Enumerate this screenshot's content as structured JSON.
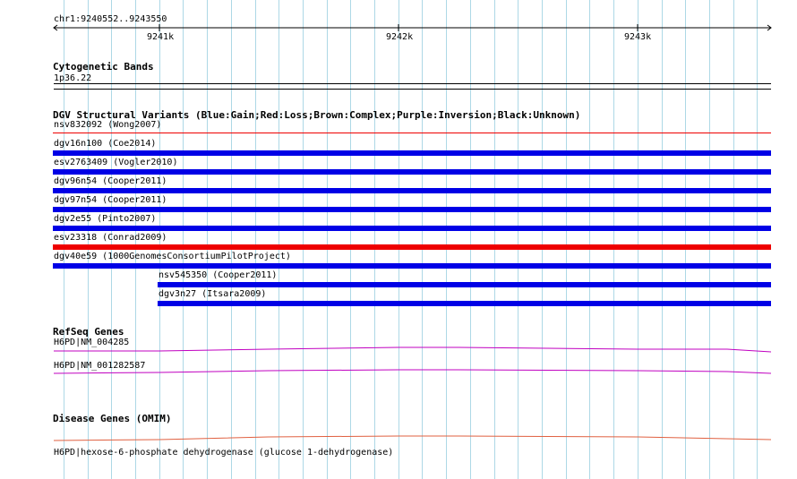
{
  "ruler": {
    "coords_label": "chr1:9240552..9243550",
    "ticks": [
      "9241k",
      "9242k",
      "9243k"
    ]
  },
  "tracks": {
    "cytoband": {
      "title": "Cytogenetic Bands",
      "band": "1p36.22"
    },
    "dgv": {
      "title": "DGV Structural Variants (Blue:Gain;Red:Loss;Brown:Complex;Purple:Inversion;Black:Unknown)",
      "variants": [
        {
          "label": "nsv832092 (Wong2007)",
          "type": "loss",
          "thin": true
        },
        {
          "label": "dgv16n100 (Coe2014)",
          "type": "gain"
        },
        {
          "label": "esv2763409 (Vogler2010)",
          "type": "gain"
        },
        {
          "label": "dgv96n54 (Cooper2011)",
          "type": "gain"
        },
        {
          "label": "dgv97n54 (Cooper2011)",
          "type": "gain"
        },
        {
          "label": "dgv2e55 (Pinto2007)",
          "type": "gain"
        },
        {
          "label": "esv23318 (Conrad2009)",
          "type": "loss"
        },
        {
          "label": "dgv40e59 (1000GenomesConsortiumPilotProject)",
          "type": "gain"
        },
        {
          "label": "nsv545350 (Cooper2011)",
          "type": "gain",
          "partial": true
        },
        {
          "label": "dgv3n27 (Itsara2009)",
          "type": "gain",
          "partial": true
        }
      ]
    },
    "refseq": {
      "title": "RefSeq Genes",
      "genes": [
        "H6PD|NM_004285",
        "H6PD|NM_001282587"
      ]
    },
    "omim": {
      "title": "Disease Genes (OMIM)",
      "entry": "H6PD|hexose-6-phosphate dehydrogenase (glucose 1-dehydrogenase)"
    }
  },
  "colors": {
    "gain": "#0000e6",
    "loss": "#ee0000",
    "gene": "#c000c0",
    "omim": "#e06040",
    "grid": "#add8e6"
  }
}
